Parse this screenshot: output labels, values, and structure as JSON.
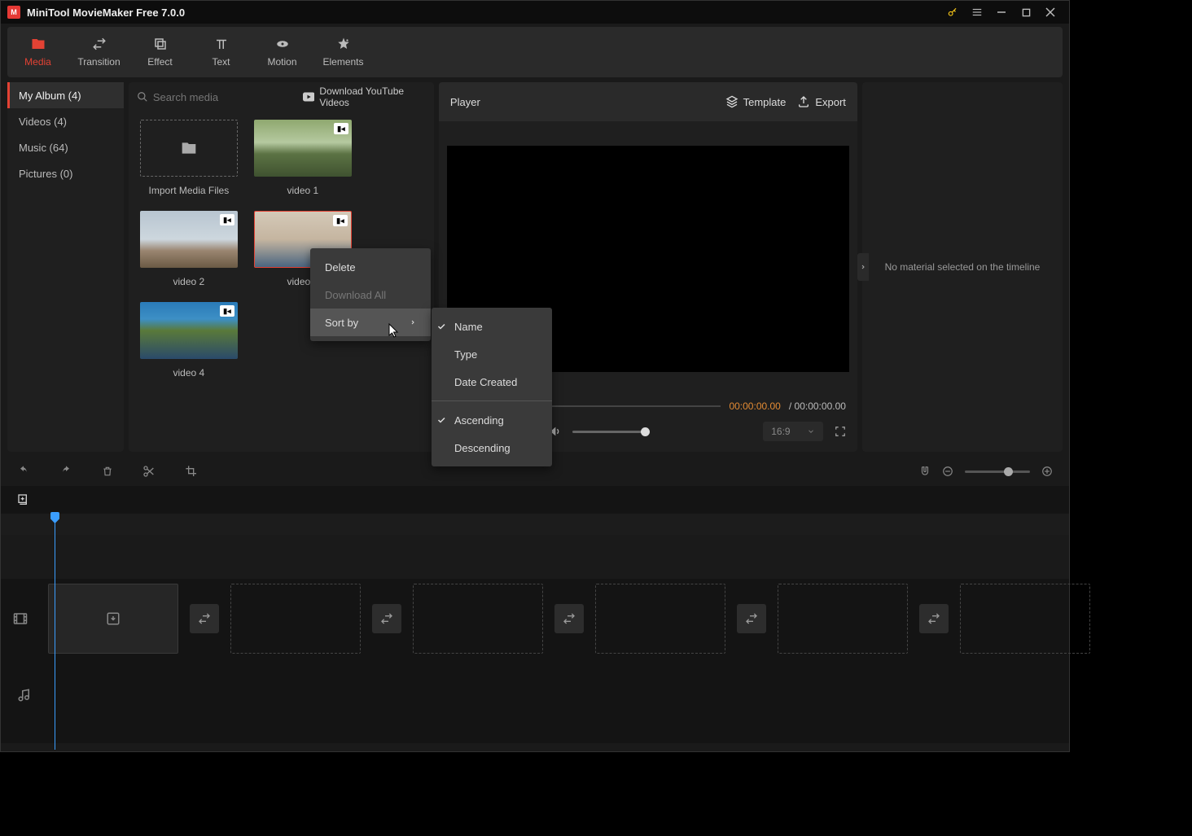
{
  "title": "MiniTool MovieMaker Free 7.0.0",
  "topbar": {
    "tabs": [
      {
        "label": "Media"
      },
      {
        "label": "Transition"
      },
      {
        "label": "Effect"
      },
      {
        "label": "Text"
      },
      {
        "label": "Motion"
      },
      {
        "label": "Elements"
      }
    ]
  },
  "sidebar": {
    "items": [
      {
        "label": "My Album (4)"
      },
      {
        "label": "Videos (4)"
      },
      {
        "label": "Music (64)"
      },
      {
        "label": "Pictures (0)"
      }
    ]
  },
  "mediaPanel": {
    "searchPlaceholder": "Search media",
    "downloadYoutube": "Download YouTube Videos",
    "import": "Import Media Files",
    "items": [
      {
        "label": "video 1"
      },
      {
        "label": "video 2"
      },
      {
        "label": "video 3"
      },
      {
        "label": "video 4"
      }
    ]
  },
  "player": {
    "title": "Player",
    "template": "Template",
    "export": "Export",
    "currentTime": "00:00:00.00",
    "totalTime": "/ 00:00:00.00",
    "ratio": "16:9"
  },
  "props": {
    "message": "No material selected on the timeline"
  },
  "contextMenu": {
    "delete": "Delete",
    "downloadAll": "Download All",
    "sortBy": "Sort by",
    "sub": {
      "name": "Name",
      "type": "Type",
      "dateCreated": "Date Created",
      "ascending": "Ascending",
      "descending": "Descending"
    }
  }
}
